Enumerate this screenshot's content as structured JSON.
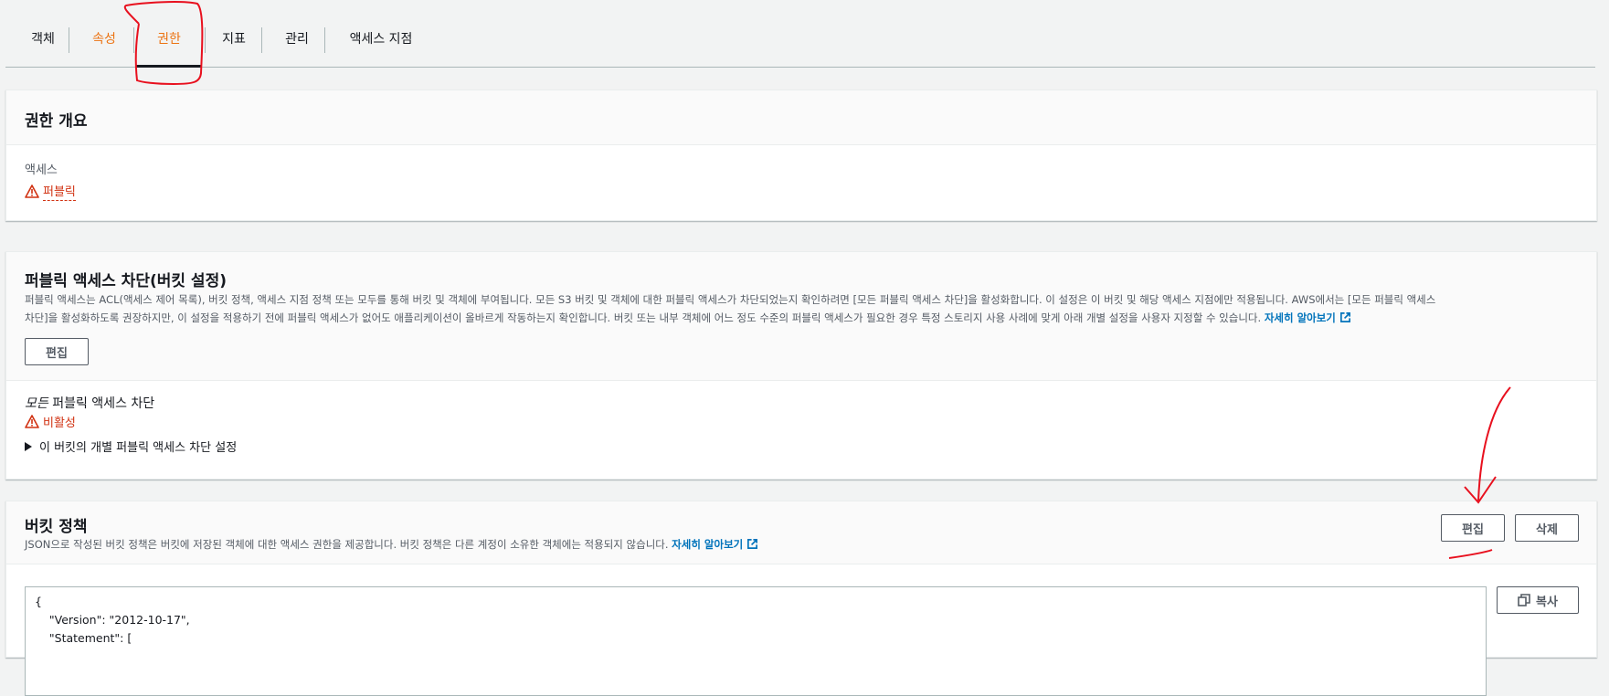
{
  "tabs": [
    {
      "label": "객체"
    },
    {
      "label": "속성"
    },
    {
      "label": "권한"
    },
    {
      "label": "지표"
    },
    {
      "label": "관리"
    },
    {
      "label": "액세스 지점"
    }
  ],
  "overview": {
    "title": "권한 개요",
    "access_label": "액세스",
    "access_value": "퍼블릭"
  },
  "block_public_access": {
    "title": "퍼블릭 액세스 차단(버킷 설정)",
    "description_line1": "퍼블릭 액세스는 ACL(액세스 제어 목록), 버킷 정책, 액세스 지점 정책 또는 모두를 통해 버킷 및 객체에 부여됩니다. 모든 S3 버킷 및 객체에 대한 퍼블릭 액세스가 차단되었는지 확인하려면 [모든 퍼블릭 액세스 차단]을 활성화합니다. 이 설정은 이 버킷 및 해당 액세스 지점에만 적용됩니다. AWS에서는 [모든 퍼블릭 액세스",
    "description_line2": "차단]을 활성화하도록 권장하지만, 이 설정을 적용하기 전에 퍼블릭 액세스가 없어도 애플리케이션이 올바르게 작동하는지 확인합니다. 버킷 또는 내부 객체에 어느 정도 수준의 퍼블릭 액세스가 필요한 경우 특정 스토리지 사용 사례에 맞게 아래 개별 설정을 사용자 지정할 수 있습니다.",
    "learn_more": "자세히 알아보기",
    "edit_button": "편집",
    "all_block_italic": "모든",
    "all_block_rest": " 퍼블릭 액세스 차단",
    "status": "비활성",
    "individual_settings": "이 버킷의 개별 퍼블릭 액세스 차단 설정"
  },
  "bucket_policy": {
    "title": "버킷 정책",
    "description": "JSON으로 작성된 버킷 정책은 버킷에 저장된 객체에 대한 액세스 권한을 제공합니다. 버킷 정책은 다른 계정이 소유한 객체에는 적용되지 않습니다.",
    "learn_more": "자세히 알아보기",
    "edit_button": "편집",
    "delete_button": "삭제",
    "copy_button": "복사",
    "code_lines": [
      "{",
      "    \"Version\": \"2012-10-17\",",
      "    \"Statement\": ["
    ]
  },
  "colors": {
    "accent": "#ec7211",
    "link": "#0073bb",
    "error": "#d13212",
    "annotation": "#e8101e"
  }
}
